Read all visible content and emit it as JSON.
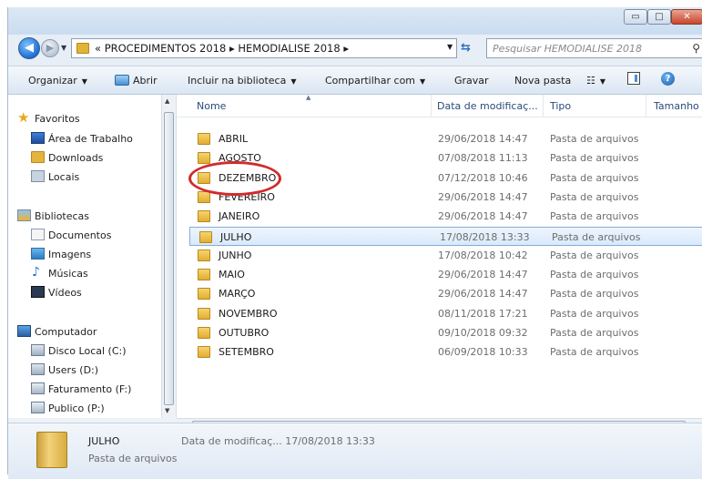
{
  "window": {
    "buttons": {
      "minimize": "▭",
      "maximize": "□",
      "close": "✕"
    }
  },
  "address": {
    "path": "« PROCEDIMENTOS 2018  ▸  HEMODIALISE 2018  ▸",
    "search_placeholder": "Pesquisar HEMODIALISE 2018"
  },
  "toolbar": {
    "organize": "Organizar",
    "open": "Abrir",
    "include_library": "Incluir na biblioteca",
    "share_with": "Compartilhar com",
    "burn": "Gravar",
    "new_folder": "Nova pasta",
    "help": "?"
  },
  "nav": {
    "favorites": "Favoritos",
    "desktop": "Área de Trabalho",
    "downloads": "Downloads",
    "places": "Locais",
    "libraries": "Bibliotecas",
    "documents": "Documentos",
    "images": "Imagens",
    "music": "Músicas",
    "videos": "Vídeos",
    "computer": "Computador",
    "local_disk": "Disco Local (C:)",
    "users": "Users (D:)",
    "billing": "Faturamento (F:)",
    "public": "Publico (P:)"
  },
  "columns": {
    "name": "Nome",
    "date": "Data de modificaç...",
    "type": "Tipo",
    "size": "Tamanho"
  },
  "files": [
    {
      "name": "ABRIL",
      "date": "29/06/2018 14:47",
      "type": "Pasta de arquivos"
    },
    {
      "name": "AGOSTO",
      "date": "07/08/2018 11:13",
      "type": "Pasta de arquivos"
    },
    {
      "name": "DEZEMBRO",
      "date": "07/12/2018 10:46",
      "type": "Pasta de arquivos"
    },
    {
      "name": "FEVEREIRO",
      "date": "29/06/2018 14:47",
      "type": "Pasta de arquivos"
    },
    {
      "name": "JANEIRO",
      "date": "29/06/2018 14:47",
      "type": "Pasta de arquivos"
    },
    {
      "name": "JULHO",
      "date": "17/08/2018 13:33",
      "type": "Pasta de arquivos"
    },
    {
      "name": "JUNHO",
      "date": "17/08/2018 10:42",
      "type": "Pasta de arquivos"
    },
    {
      "name": "MAIO",
      "date": "29/06/2018 14:47",
      "type": "Pasta de arquivos"
    },
    {
      "name": "MARÇO",
      "date": "29/06/2018 14:47",
      "type": "Pasta de arquivos"
    },
    {
      "name": "NOVEMBRO",
      "date": "08/11/2018 17:21",
      "type": "Pasta de arquivos"
    },
    {
      "name": "OUTUBRO",
      "date": "09/10/2018 09:32",
      "type": "Pasta de arquivos"
    },
    {
      "name": "SETEMBRO",
      "date": "06/09/2018 10:33",
      "type": "Pasta de arquivos"
    }
  ],
  "selected_index": 5,
  "highlighted_index": 2,
  "details": {
    "name": "JULHO",
    "type": "Pasta de arquivos",
    "date": "Data de modificaç... 17/08/2018 13:33"
  },
  "colors": {
    "annotation": "#d22a2a",
    "selection_border": "#84acdd"
  }
}
